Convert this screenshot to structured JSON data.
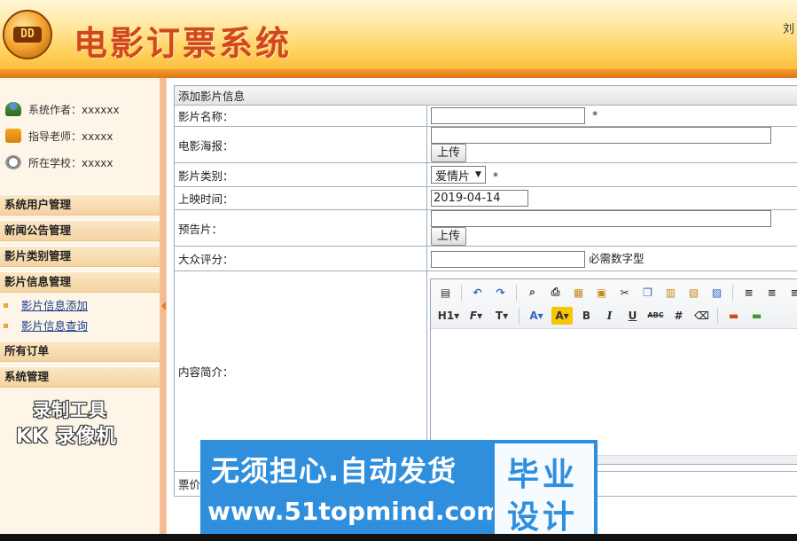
{
  "header": {
    "logo_text": "DD",
    "title": "电影订票系统",
    "corner_text": "刘"
  },
  "sidebar": {
    "info": [
      {
        "icon": "user-icon",
        "text": "系统作者：xxxxxx"
      },
      {
        "icon": "teacher-icon",
        "text": "指导老师：xxxxx"
      },
      {
        "icon": "clock-icon",
        "text": "所在学校：xxxxx"
      }
    ],
    "menu": [
      {
        "label": "系统用户管理"
      },
      {
        "label": "新闻公告管理"
      },
      {
        "label": "影片类别管理"
      },
      {
        "label": "影片信息管理"
      },
      {
        "label": "所有订单"
      },
      {
        "label": "系统管理"
      }
    ],
    "sub_items": [
      {
        "label": "影片信息添加"
      },
      {
        "label": "影片信息查询"
      }
    ],
    "watermark": {
      "line1": "录制工具",
      "line2": "KK 录像机"
    }
  },
  "form": {
    "title": "添加影片信息",
    "rows": {
      "name": {
        "label": "影片名称：",
        "value": "",
        "required": "*"
      },
      "poster": {
        "label": "电影海报：",
        "value": "",
        "button": "上传"
      },
      "category": {
        "label": "影片类别：",
        "value": "爱情片",
        "required": "*"
      },
      "release": {
        "label": "上映时间：",
        "value": "2019-04-14"
      },
      "trailer": {
        "label": "预告片：",
        "value": "",
        "button": "上传"
      },
      "rating": {
        "label": "大众评分：",
        "value": "",
        "hint": "必需数字型"
      },
      "intro": {
        "label": "内容简介："
      },
      "price": {
        "label": "票价："
      }
    }
  },
  "editor": {
    "toolbar_row1": [
      "source-icon",
      "undo-icon",
      "redo-icon",
      "preview-icon",
      "print-icon",
      "template-icon",
      "paste-word-icon",
      "cut-icon",
      "copy-icon",
      "paste-icon",
      "paste-text-icon",
      "paste-word2-icon",
      "align-left-icon",
      "align-center-icon",
      "align-right-icon"
    ],
    "toolbar_row2": [
      "H1",
      "F",
      "T",
      "A",
      "A",
      "B",
      "I",
      "U",
      "ABC",
      "###",
      "clear"
    ]
  },
  "promo": {
    "line1": "无须担心.自动发货",
    "line2": "www.51topmind.com",
    "badge_line1": "毕业",
    "badge_line2": "设计",
    "color": "#2f8fdd"
  }
}
